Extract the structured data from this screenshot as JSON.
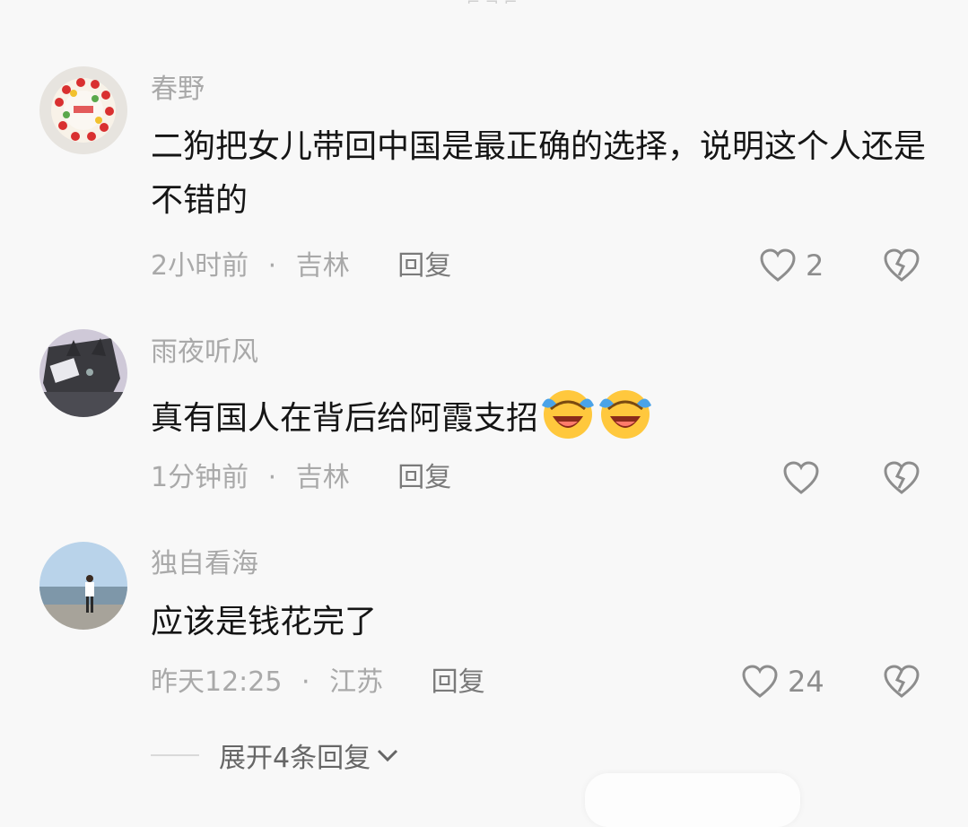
{
  "comments": [
    {
      "username": "春野",
      "text": "二狗把女儿带回中国是最正确的选择，说明这个人还是不错的",
      "time": "2小时前",
      "separator": "·",
      "location": "吉林",
      "reply_label": "回复",
      "likes": "2",
      "avatar_icon": "cake-avatar"
    },
    {
      "username": "雨夜听风",
      "text": "真有国人在背后给阿霞支招",
      "emojis": [
        "laugh-cry-emoji",
        "laugh-cry-emoji"
      ],
      "time": "1分钟前",
      "separator": "·",
      "location": "吉林",
      "reply_label": "回复",
      "likes": "",
      "avatar_icon": "cat-avatar"
    },
    {
      "username": "独自看海",
      "text": "应该是钱花完了",
      "time": "昨天12:25",
      "separator": "·",
      "location": "江苏",
      "reply_label": "回复",
      "likes": "24",
      "avatar_icon": "beach-person-avatar"
    }
  ],
  "expand_replies": {
    "label": "展开4条回复",
    "icon": "chevron-down-icon"
  },
  "colors": {
    "background": "#f8f8f8",
    "text": "#151515",
    "secondary": "#a9a9a9",
    "emoji": "#ffc83d"
  }
}
